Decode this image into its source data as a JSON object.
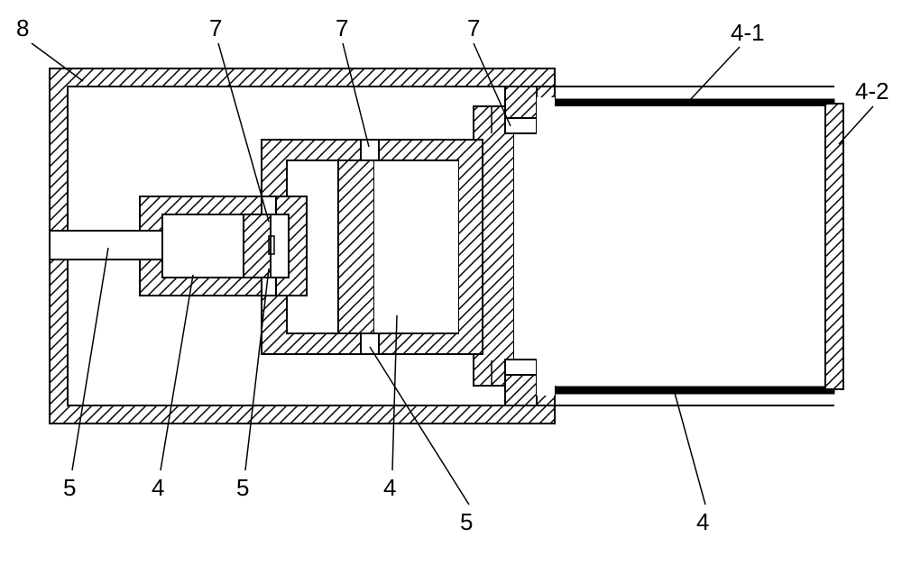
{
  "labels": {
    "l8": "8",
    "l7a": "7",
    "l7b": "7",
    "l7c": "7",
    "l41": "4-1",
    "l42": "4-2",
    "l5a": "5",
    "l4a": "4",
    "l5b": "5",
    "l4b": "4",
    "l5c": "5",
    "l4c": "4"
  }
}
